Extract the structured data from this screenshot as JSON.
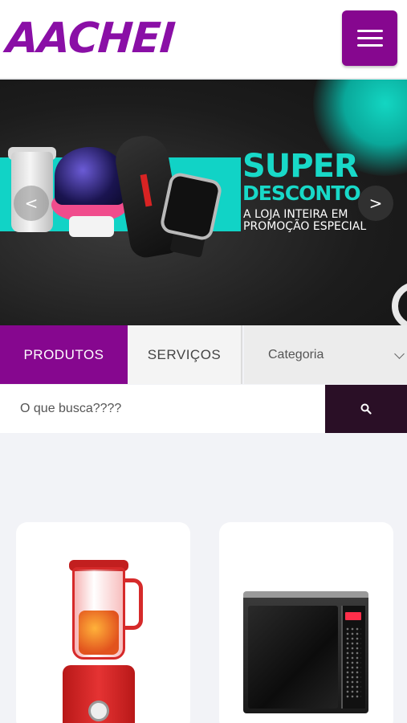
{
  "header": {
    "logo_text": "AACHEI",
    "menu_icon": "hamburger-menu-icon",
    "brand_color": "#86078f"
  },
  "banner": {
    "title": "SUPER",
    "subtitle": "DESCONTO",
    "line1": "A LOJA INTEIRA EM",
    "line2": "PROMOÇÃO ESPECIAL",
    "prev_label": "<",
    "next_label": ">",
    "accent_color": "#18d9c8"
  },
  "tabs": {
    "products": "PRODUTOS",
    "services": "SERVIÇOS",
    "category": "Categoria"
  },
  "search": {
    "placeholder": "O que busca????",
    "button_icon": "search-icon"
  },
  "products": [
    {
      "name": "blender",
      "icon": "blender-image"
    },
    {
      "name": "microwave",
      "icon": "microwave-image"
    }
  ]
}
